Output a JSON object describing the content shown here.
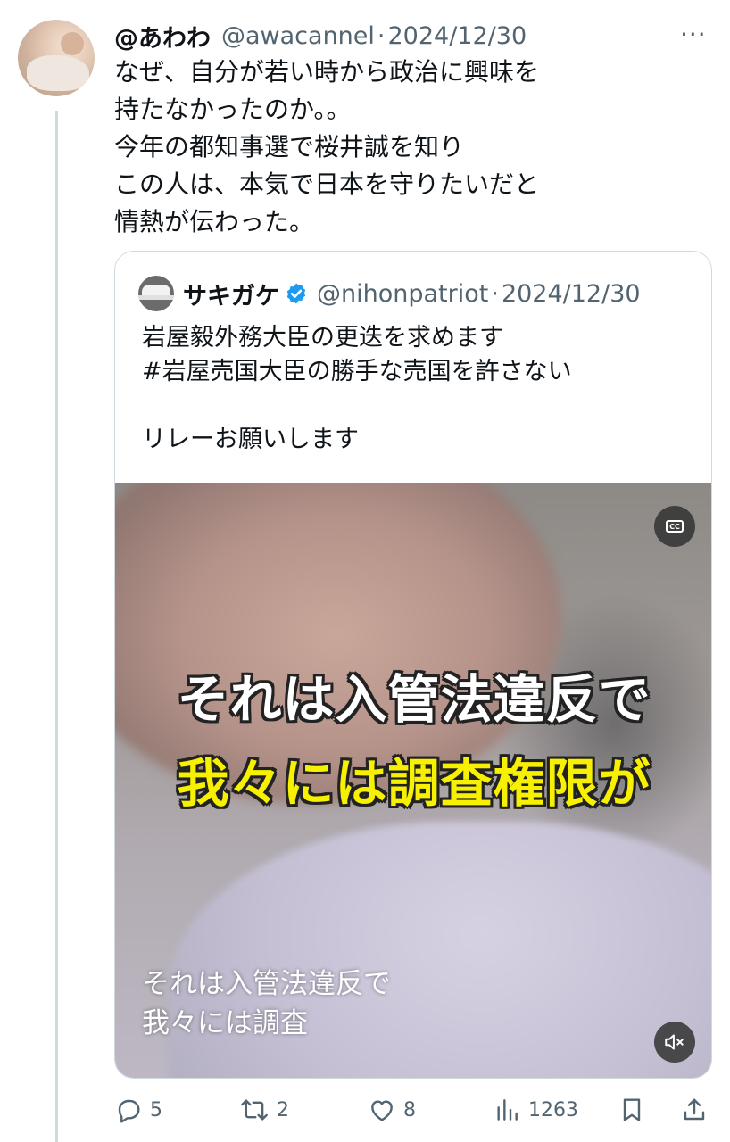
{
  "tweet": {
    "display_name": "@あわわ",
    "handle": "@awacannel",
    "separator": "·",
    "date": "2024/12/30",
    "more_icon": "ellipsis-icon",
    "text_lines": [
      "なぜ、自分が若い時から政治に興味を",
      "持たなかったのか。。",
      "今年の都知事選で桜井誠を知り",
      "この人は、本気で日本を守りたいだと",
      "情熱が伝わった。"
    ]
  },
  "quote": {
    "display_name": "サキガケ",
    "verified": true,
    "handle": "@nihonpatriot",
    "separator": "·",
    "date": "2024/12/30",
    "text_lines": [
      "岩屋毅外務大臣の更迭を求めます",
      "#岩屋売国大臣の勝手な売国を許さない",
      "",
      "リレーお願いします"
    ],
    "video": {
      "caption_line1": "それは入管法違反で",
      "caption_line2": "我々には調査権限が",
      "subtitle_line1": "それは入管法違反で",
      "subtitle_line2": "我々には調査",
      "cc_label": "CC"
    }
  },
  "actions": {
    "replies": "5",
    "reposts": "2",
    "likes": "8",
    "views": "1263"
  },
  "colors": {
    "text": "#0f1419",
    "secondary": "#536471",
    "border": "#cfd9de",
    "verified": "#1d9bf0",
    "caption_yellow": "#f7f000"
  }
}
